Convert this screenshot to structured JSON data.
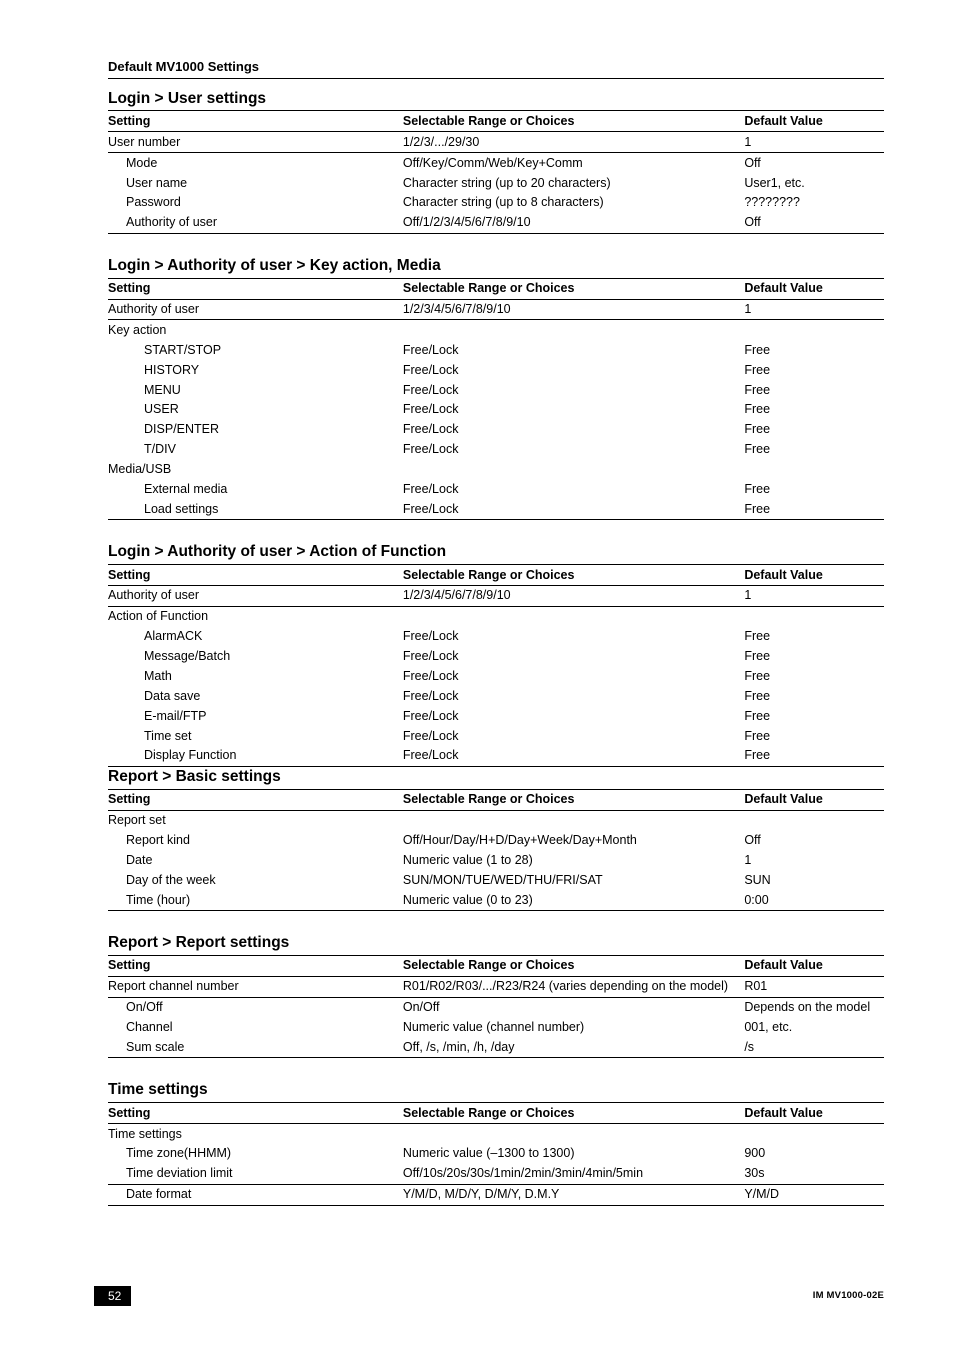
{
  "doc_section": "Default MV1000 Settings",
  "columns": {
    "setting": "Setting",
    "range": "Selectable Range or Choices",
    "default": "Default Value"
  },
  "sections": [
    {
      "title": "Login > User settings",
      "rows": [
        {
          "s": "User number",
          "r": "1/2/3/.../29/30",
          "d": "1",
          "i": 0,
          "sep": true
        },
        {
          "s": "Mode",
          "r": "Off/Key/Comm/Web/Key+Comm",
          "d": "Off",
          "i": 1
        },
        {
          "s": "User name",
          "r": "Character string (up to 20 characters)",
          "d": "User1, etc.",
          "i": 1
        },
        {
          "s": "Password",
          "r": "Character string (up to 8 characters)",
          "d": "????????",
          "i": 1
        },
        {
          "s": "Authority of user",
          "r": "Off/1/2/3/4/5/6/7/8/9/10",
          "d": "Off",
          "i": 1,
          "last": true
        }
      ]
    },
    {
      "title": "Login > Authority of user > Key action, Media",
      "rows": [
        {
          "s": "Authority of user",
          "r": "1/2/3/4/5/6/7/8/9/10",
          "d": "1",
          "i": 0,
          "sep": true
        },
        {
          "s": "Key action",
          "r": "",
          "d": "",
          "i": 0
        },
        {
          "s": "START/STOP",
          "r": "Free/Lock",
          "d": "Free",
          "i": 2
        },
        {
          "s": "HISTORY",
          "r": "Free/Lock",
          "d": "Free",
          "i": 2
        },
        {
          "s": "MENU",
          "r": "Free/Lock",
          "d": "Free",
          "i": 2
        },
        {
          "s": "USER",
          "r": "Free/Lock",
          "d": "Free",
          "i": 2
        },
        {
          "s": "DISP/ENTER",
          "r": "Free/Lock",
          "d": "Free",
          "i": 2
        },
        {
          "s": "T/DIV",
          "r": "Free/Lock",
          "d": "Free",
          "i": 2
        },
        {
          "s": "Media/USB",
          "r": "",
          "d": "",
          "i": 0
        },
        {
          "s": "External media",
          "r": "Free/Lock",
          "d": "Free",
          "i": 2
        },
        {
          "s": "Load settings",
          "r": "Free/Lock",
          "d": "Free",
          "i": 2,
          "last": true
        }
      ]
    },
    {
      "title": "Login > Authority of user > Action of Function",
      "rows": [
        {
          "s": "Authority of user",
          "r": "1/2/3/4/5/6/7/8/9/10",
          "d": "1",
          "i": 0,
          "sep": true
        },
        {
          "s": "Action of Function",
          "r": "",
          "d": "",
          "i": 0
        },
        {
          "s": "AlarmACK",
          "r": "Free/Lock",
          "d": "Free",
          "i": 2
        },
        {
          "s": "Message/Batch",
          "r": "Free/Lock",
          "d": "Free",
          "i": 2
        },
        {
          "s": "Math",
          "r": "Free/Lock",
          "d": "Free",
          "i": 2
        },
        {
          "s": "Data save",
          "r": "Free/Lock",
          "d": "Free",
          "i": 2
        },
        {
          "s": "E-mail/FTP",
          "r": "Free/Lock",
          "d": "Free",
          "i": 2
        },
        {
          "s": "Time set",
          "r": "Free/Lock",
          "d": "Free",
          "i": 2
        },
        {
          "s": "Display Function",
          "r": "Free/Lock",
          "d": "Free",
          "i": 2,
          "last": true
        }
      ]
    },
    {
      "title": "Report > Basic settings",
      "nomargin_top": true,
      "rows": [
        {
          "s": "Report set",
          "r": "",
          "d": "",
          "i": 0
        },
        {
          "s": "Report kind",
          "r": "Off/Hour/Day/H+D/Day+Week/Day+Month",
          "d": "Off",
          "i": 1
        },
        {
          "s": "Date",
          "r": "Numeric value (1 to 28)",
          "d": "1",
          "i": 1
        },
        {
          "s": "Day of the week",
          "r": "SUN/MON/TUE/WED/THU/FRI/SAT",
          "d": "SUN",
          "i": 1
        },
        {
          "s": "Time (hour)",
          "r": "Numeric value (0 to 23)",
          "d": "0:00",
          "i": 1,
          "last": true
        }
      ]
    },
    {
      "title": "Report > Report settings",
      "rows": [
        {
          "s": "Report channel number",
          "r": "R01/R02/R03/.../R23/R24 (varies depending on the model)",
          "d": "R01",
          "i": 0,
          "sep": true
        },
        {
          "s": "On/Off",
          "r": "On/Off",
          "d": "Depends on the model",
          "i": 1
        },
        {
          "s": "Channel",
          "r": "Numeric value (channel number)",
          "d": "001, etc.",
          "i": 1
        },
        {
          "s": "Sum scale",
          "r": "Off,  /s,  /min,  /h,  /day",
          "d": "/s",
          "i": 1,
          "last": true
        }
      ]
    },
    {
      "title": "Time settings",
      "rows": [
        {
          "s": "Time settings",
          "r": "",
          "d": "",
          "i": 0
        },
        {
          "s": "Time zone(HHMM)",
          "r": "Numeric value (–1300 to 1300)",
          "d": "900",
          "i": 1
        },
        {
          "s": "Time deviation limit",
          "r": "Off/10s/20s/30s/1min/2min/3min/4min/5min",
          "d": "30s",
          "i": 1,
          "sep": true
        },
        {
          "s": "Date format",
          "r": "Y/M/D, M/D/Y, D/M/Y, D.M.Y",
          "d": "Y/M/D",
          "i": 1,
          "last": true
        }
      ]
    }
  ],
  "footer": {
    "page": "52",
    "manual": "IM MV1000-02E"
  }
}
